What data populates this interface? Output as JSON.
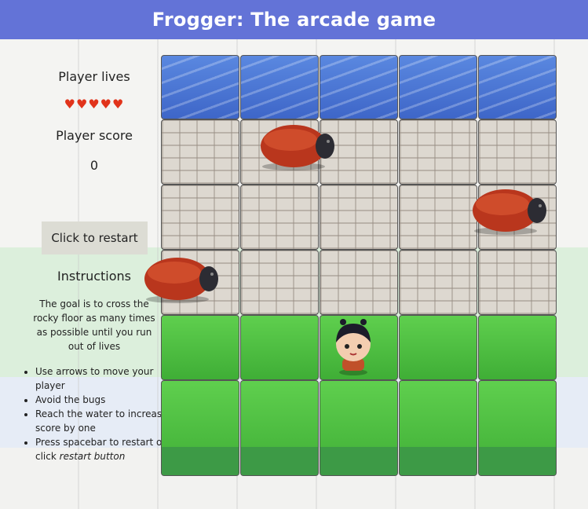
{
  "header": {
    "title": "Frogger: The arcade game"
  },
  "sidebar": {
    "lives_label": "Player lives",
    "lives": 5,
    "hearts": "♥♥♥♥♥",
    "score_label": "Player score",
    "score": "0",
    "restart_label": "Click to restart",
    "instructions_title": "Instructions",
    "instructions_text": "The goal is to cross the rocky floor as many times as possible until you run out of lives",
    "instructions_list": [
      "Use arrows to move your player",
      "Avoid the bugs",
      "Reach the water to increase score by one",
      "Press spacebar to restart or click"
    ],
    "restart_hint_italic": "restart button"
  },
  "board": {
    "rows": [
      "water",
      "stone",
      "stone",
      "stone",
      "grass",
      "grass"
    ],
    "columns": 5
  },
  "colors": {
    "header": "#6373d7",
    "hearts": "#e1331b",
    "button_bg": "#dcdcd4"
  }
}
